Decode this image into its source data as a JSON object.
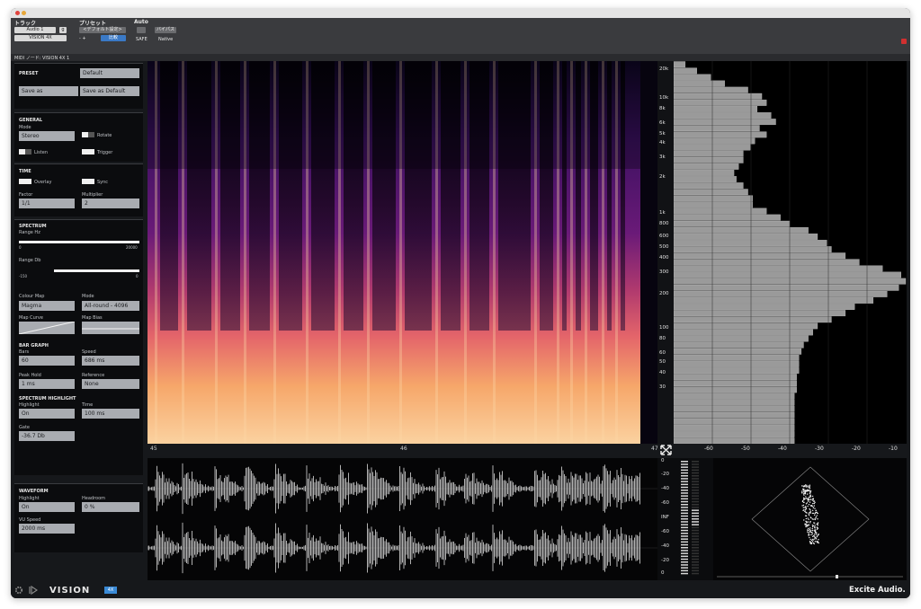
{
  "host": {
    "labels": {
      "track": "トラック",
      "preset": "プリセット",
      "auto": "Auto"
    },
    "track_select": "Audio 1",
    "track_button": "g",
    "plugin_select": "VISION 4X",
    "preset_select": "<デフォルト設定>",
    "compare_label": "比較",
    "bypass_label": "バイパス",
    "safe_label": "SAFE",
    "native_label": "Native",
    "midi_node": "MIDI ノード: VISION 4X 1",
    "plus_minus": "- +"
  },
  "panel": {
    "preset": {
      "heading": "PRESET",
      "default_field": "Default",
      "save_as": "Save as",
      "save_as_default": "Save as Default"
    },
    "general": {
      "heading": "GENERAL",
      "mode_label": "Mode",
      "mode_value": "Stereo",
      "rotate": "Rotate",
      "listen": "Listen",
      "trigger": "Trigger"
    },
    "time": {
      "heading": "TIME",
      "overlay": "Overlay",
      "sync": "Sync",
      "factor_label": "Factor",
      "factor_value": "1/1",
      "multiplier_label": "Multiplier",
      "multiplier_value": "2"
    },
    "spectrum": {
      "heading": "SPECTRUM",
      "range_hz": "Range Hz",
      "hz_min": "0",
      "hz_max": "20000",
      "range_db": "Range Db",
      "db_min": "-150",
      "db_max": "0",
      "colour_map_label": "Colour Map",
      "colour_map_value": "Magma",
      "mode_label": "Mode",
      "mode_value": "All-round - 4096",
      "map_curve": "Map Curve",
      "map_bias": "Map Bias"
    },
    "bar_graph": {
      "heading": "BAR GRAPH",
      "bars_label": "Bars",
      "bars_value": "60",
      "speed_label": "Speed",
      "speed_value": "686 ms",
      "peak_hold_label": "Peak Hold",
      "peak_hold_value": "1 ms",
      "reference_label": "Reference",
      "reference_value": "None"
    },
    "highlight": {
      "heading": "SPECTRUM HIGHLIGHT",
      "highlight_label": "Highlight",
      "highlight_value": "On",
      "time_label": "Time",
      "time_value": "100 ms",
      "gate_label": "Gate",
      "gate_value": "-36.7 Db"
    },
    "waveform": {
      "heading": "WAVEFORM",
      "highlight_label": "Highlight",
      "highlight_value": "On",
      "headroom_label": "Headroom",
      "headroom_value": "0 %",
      "vu_label": "VU Speed",
      "vu_value": "2000 ms"
    }
  },
  "timeline": {
    "labels": [
      "45",
      "46",
      "47"
    ]
  },
  "freq_labels": [
    "20k",
    "10k",
    "8k",
    "6k",
    "5k",
    "4k",
    "3k",
    "2k",
    "1k",
    "800",
    "600",
    "500",
    "400",
    "300",
    "200",
    "100",
    "80",
    "60",
    "50",
    "40",
    "30"
  ],
  "db_labels": [
    "-60",
    "-50",
    "-40",
    "-30",
    "-20",
    "-10"
  ],
  "meter_labels": [
    "0",
    "-20",
    "-40",
    "-60",
    "INF",
    "-60",
    "-40",
    "-20",
    "0"
  ],
  "footer": {
    "logo": "VISION",
    "version": "4X",
    "brand": "Excite Audio."
  },
  "colors": {
    "accent": "#3a8ad6",
    "close": "#d03030"
  }
}
